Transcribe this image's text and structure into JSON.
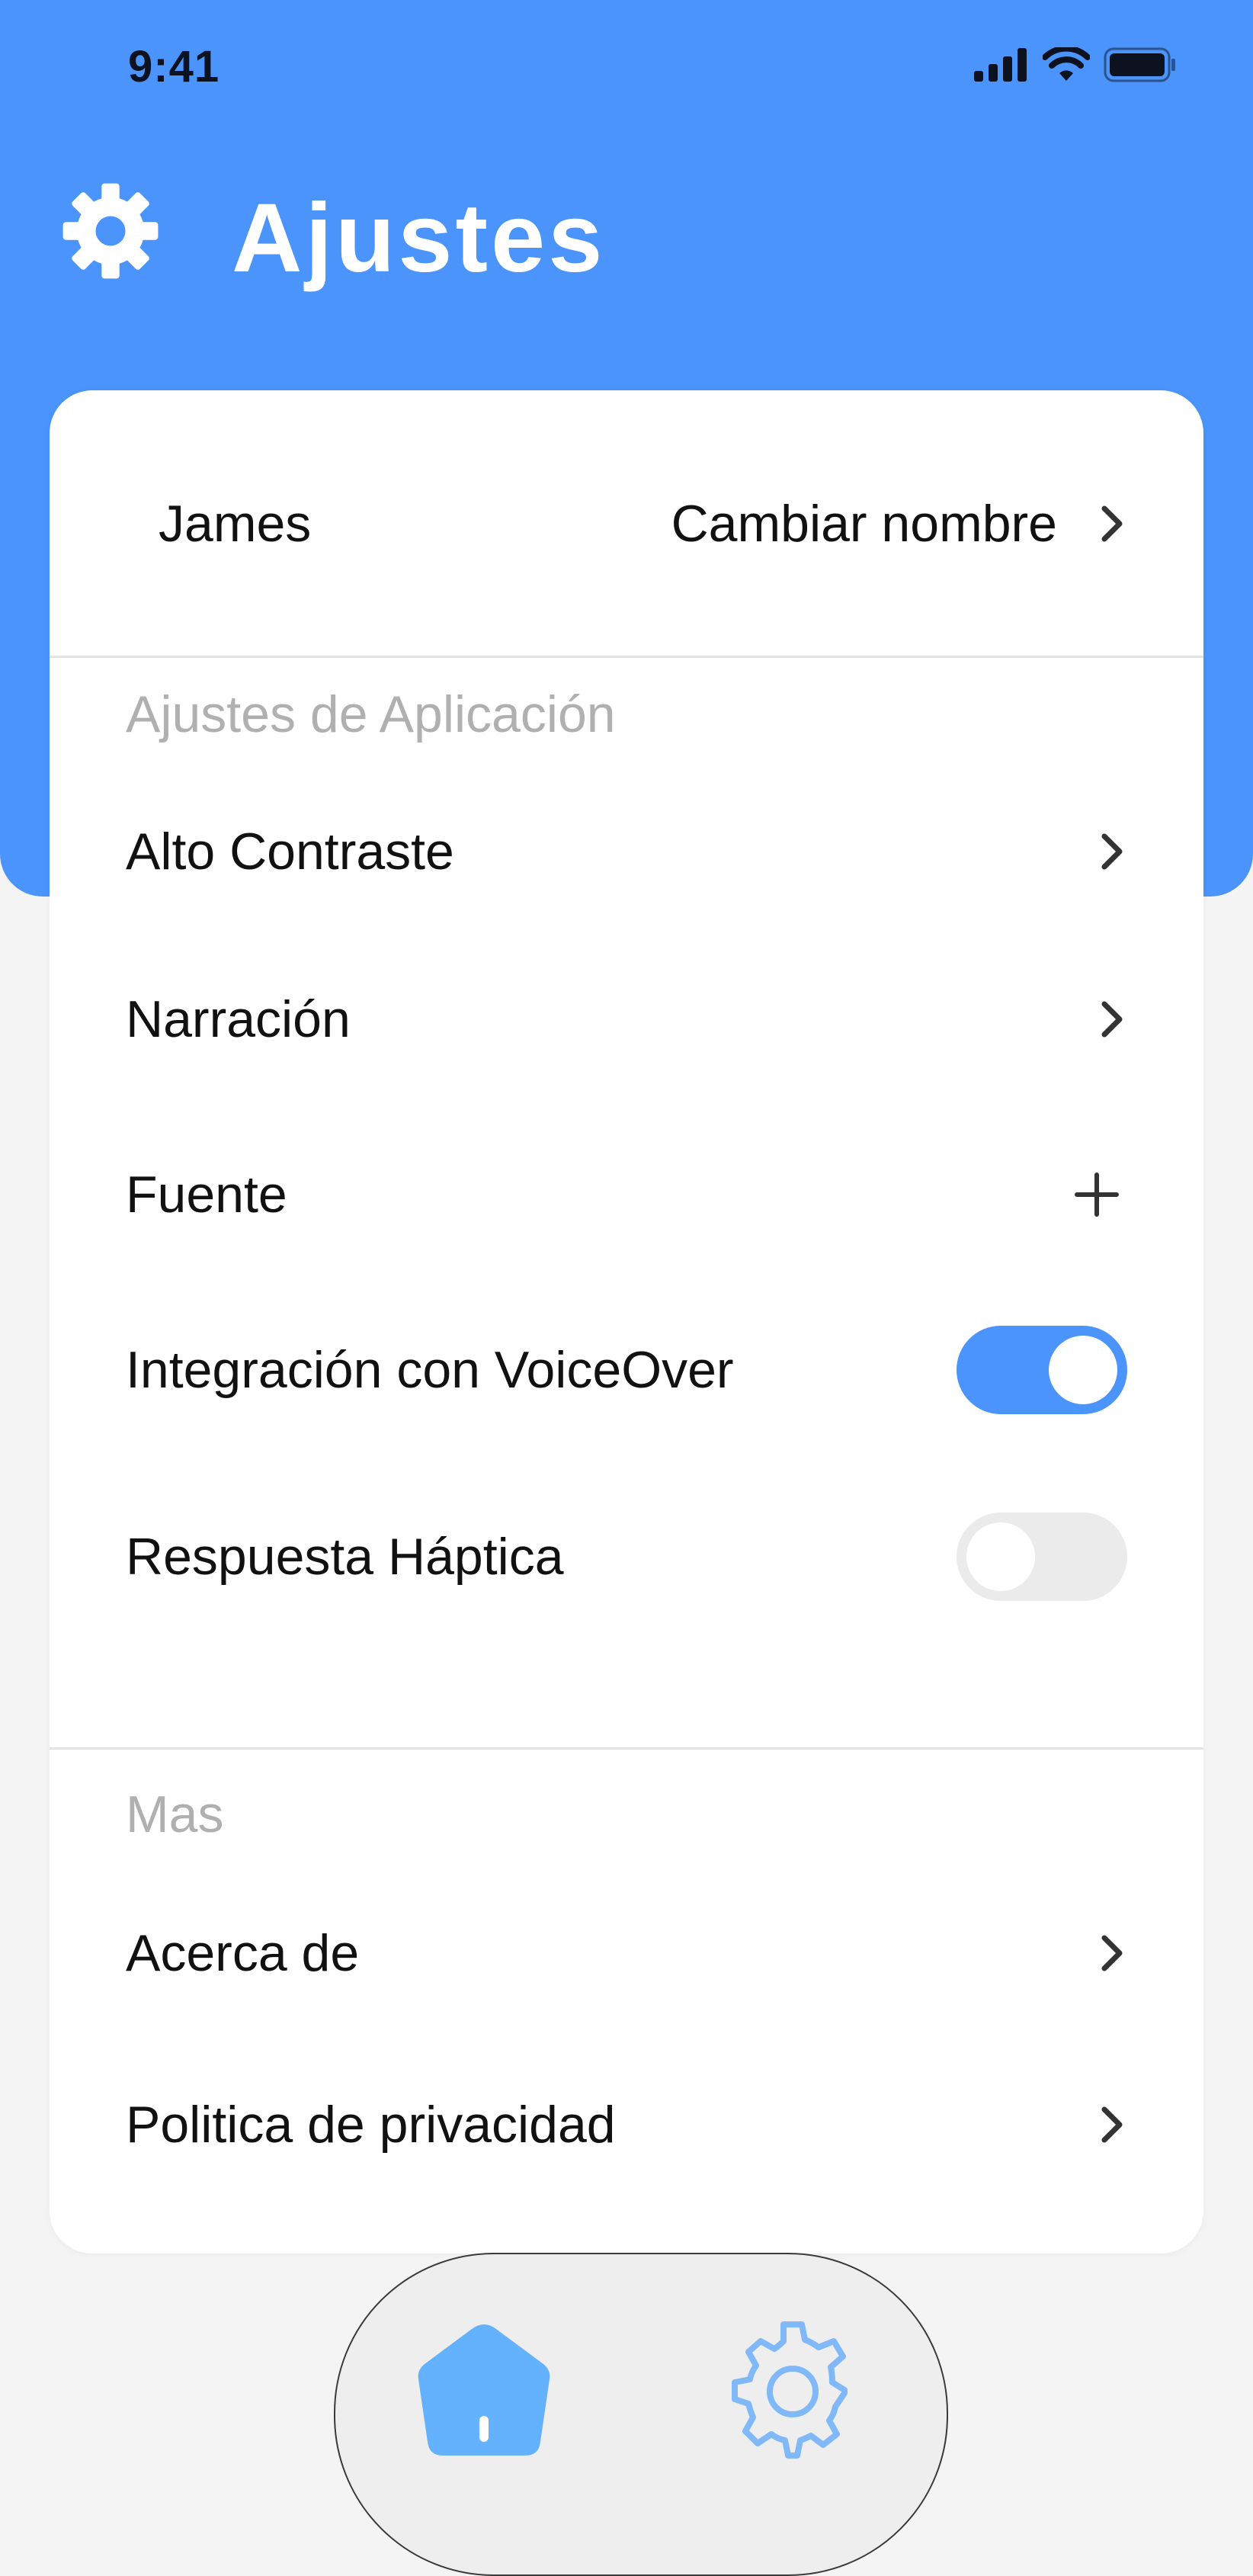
{
  "status_bar": {
    "time": "9:41",
    "icons": [
      "signal-icon",
      "wifi-icon",
      "battery-icon"
    ]
  },
  "header": {
    "icon": "gear-icon",
    "title": "Ajustes"
  },
  "profile": {
    "name": "James",
    "action_label": "Cambiar nombre"
  },
  "app_settings": {
    "section_title": "Ajustes de Aplicación",
    "items": [
      {
        "label": "Alto Contraste",
        "control": "chevron"
      },
      {
        "label": "Narración",
        "control": "chevron"
      },
      {
        "label": "Fuente",
        "control": "plus"
      },
      {
        "label": "Integración con VoiceOver",
        "control": "toggle",
        "value": true
      },
      {
        "label": "Respuesta Háptica",
        "control": "toggle",
        "value": false
      }
    ]
  },
  "more": {
    "section_title": "Mas",
    "items": [
      {
        "label": "Acerca de",
        "control": "chevron"
      },
      {
        "label": "Politica de privacidad",
        "control": "chevron"
      }
    ]
  },
  "tab_bar": {
    "tabs": [
      {
        "icon": "home-icon",
        "active": true
      },
      {
        "icon": "settings-icon",
        "active": false
      }
    ]
  },
  "colors": {
    "accent": "#4a94fb",
    "background": "#f4f4f4",
    "card": "#ffffff",
    "muted_text": "#b0b0b0"
  }
}
